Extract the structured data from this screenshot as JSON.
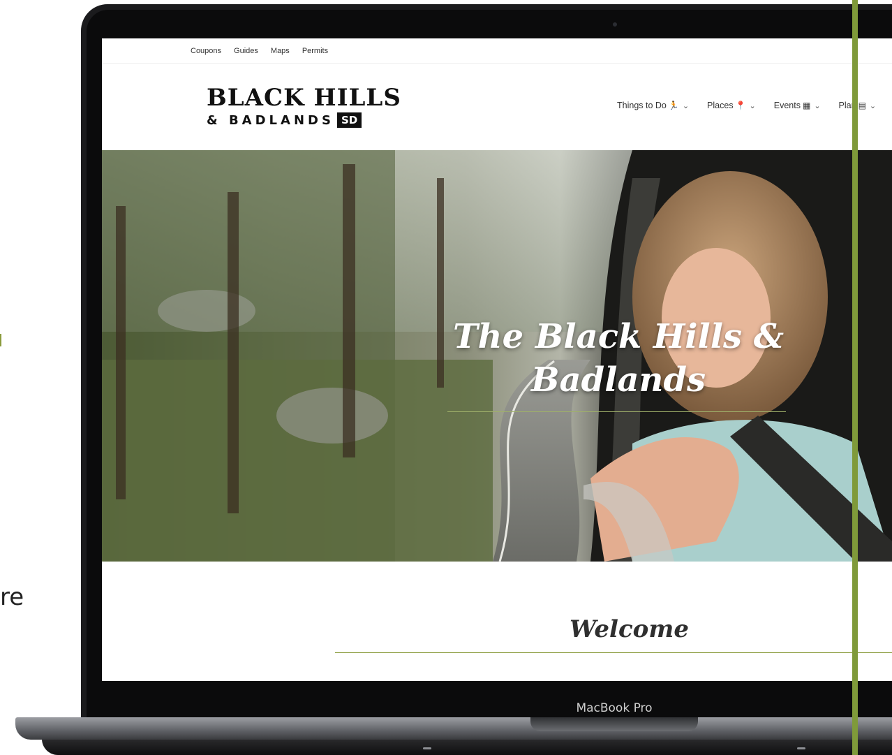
{
  "utility_nav": [
    "Coupons",
    "Guides",
    "Maps",
    "Permits"
  ],
  "logo": {
    "line1": "BLACK HILLS",
    "line2": "& BADLANDS",
    "badge": "SD"
  },
  "main_nav": [
    {
      "label": "Things to Do",
      "icon": "hiking-icon",
      "glyph": "🏃"
    },
    {
      "label": "Places",
      "icon": "map-pin-icon",
      "glyph": "📍"
    },
    {
      "label": "Events",
      "icon": "calendar-icon",
      "glyph": "▦"
    },
    {
      "label": "Plan",
      "icon": "clipboard-icon",
      "glyph": "▤"
    }
  ],
  "hero": {
    "title": "The Black Hills & Badlands"
  },
  "welcome": {
    "heading": "Welcome"
  },
  "laptop": {
    "model": "MacBook Pro"
  },
  "side_fragment": "re",
  "colors": {
    "accent_green": "#7f9a3a",
    "rule_green": "#9fb06a"
  }
}
